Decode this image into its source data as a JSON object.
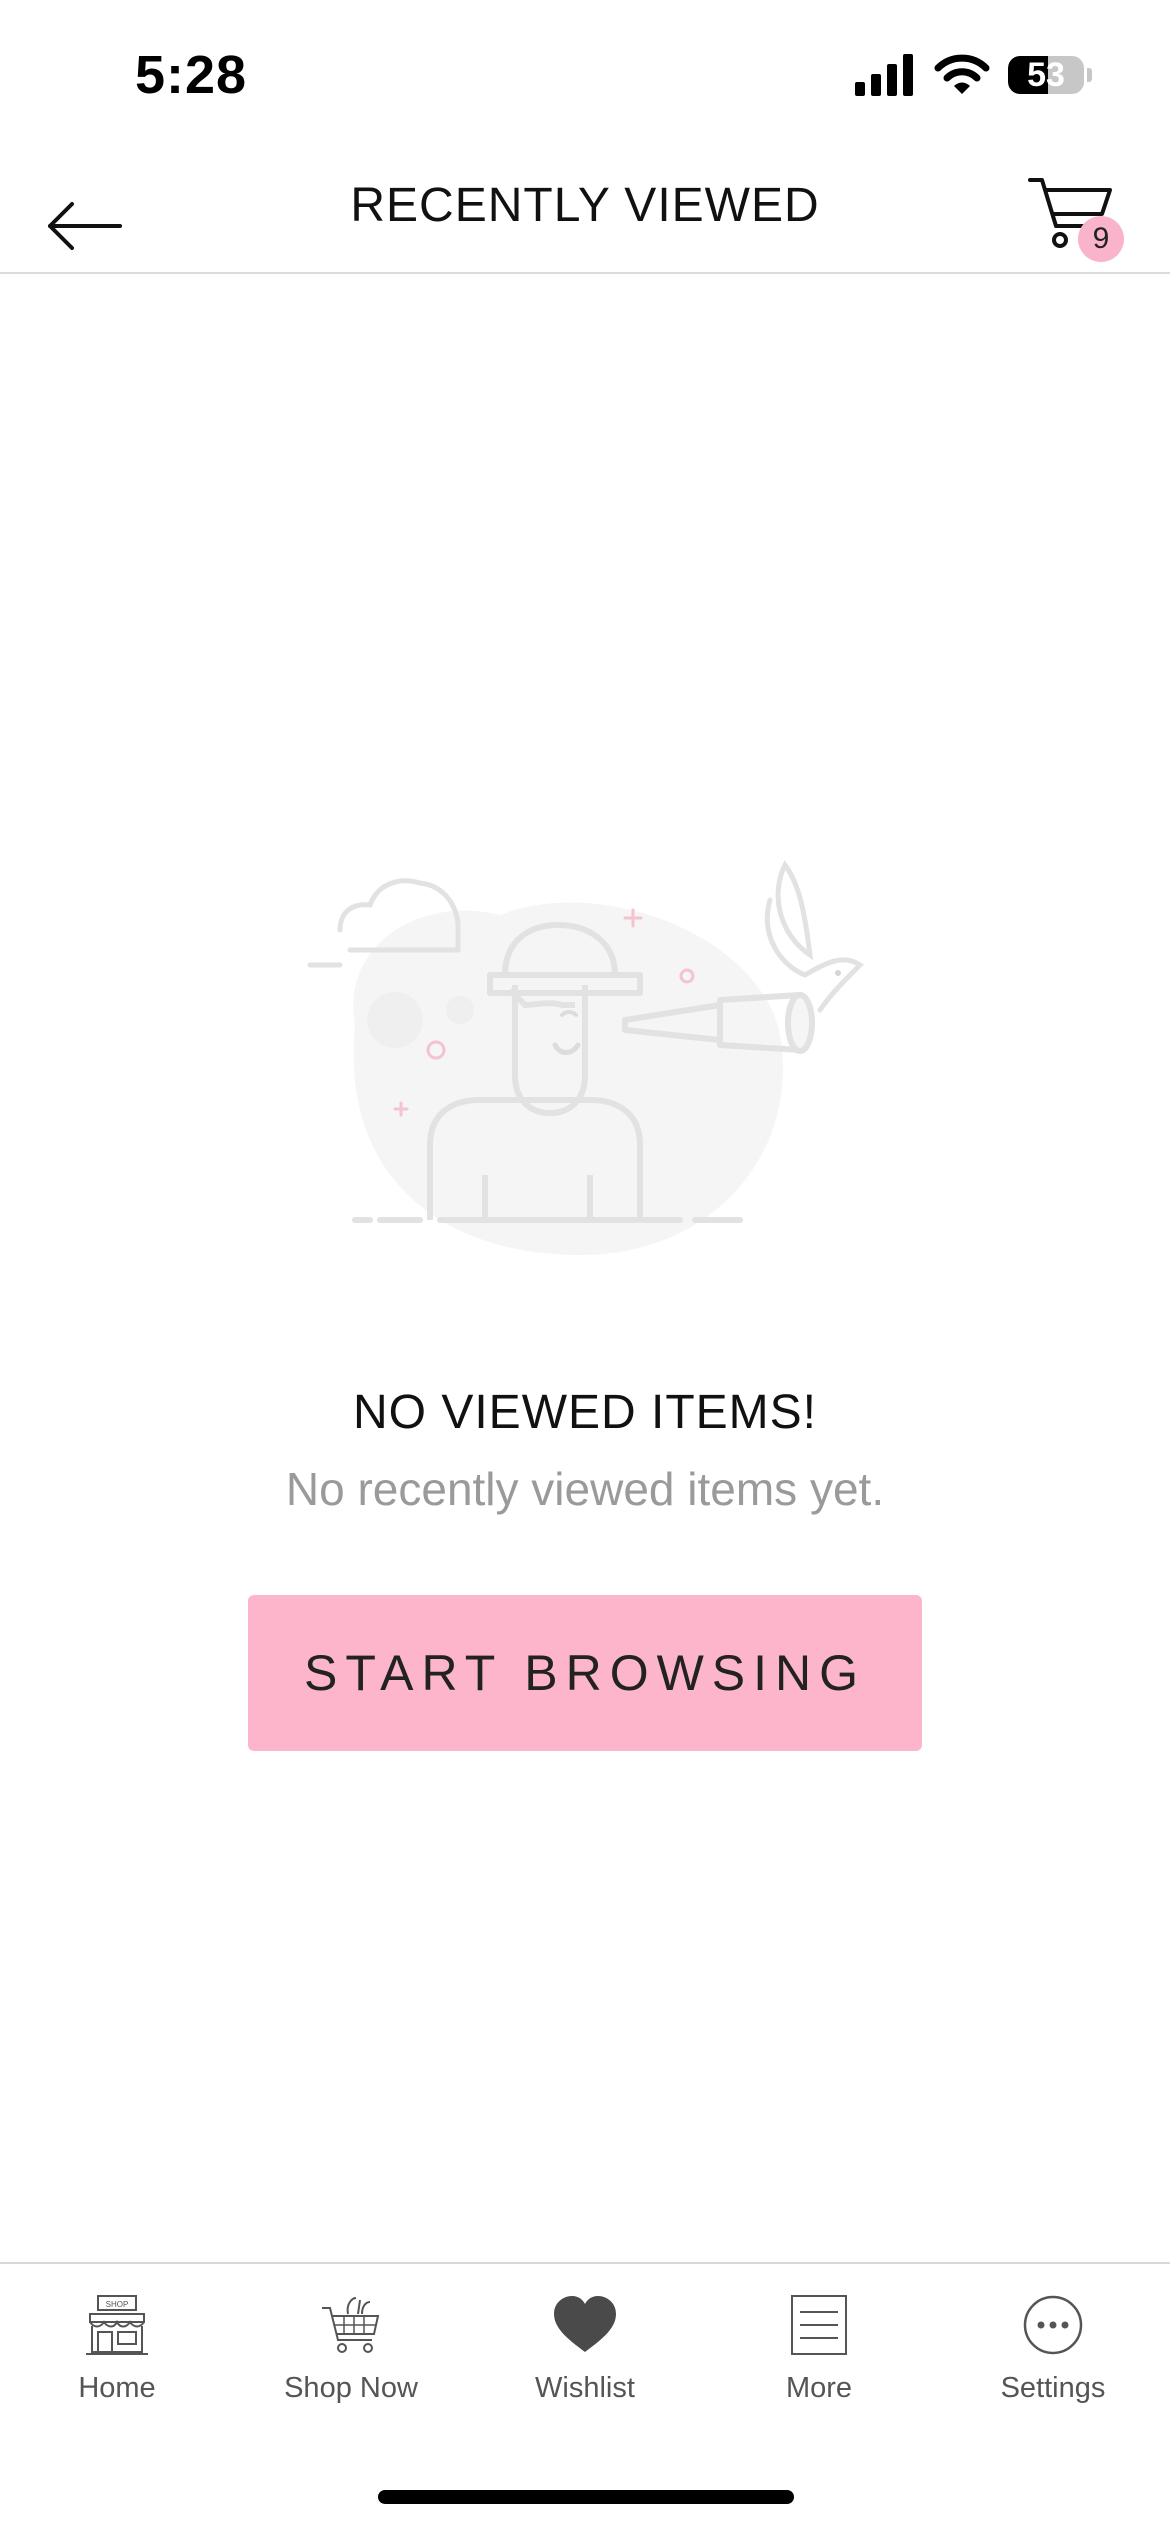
{
  "status_bar": {
    "time": "5:28",
    "battery": "53",
    "battery_level": 0.53
  },
  "header": {
    "title": "RECENTLY VIEWED",
    "cart_count": "9"
  },
  "empty_state": {
    "title": "NO VIEWED ITEMS!",
    "subtitle": "No recently viewed items yet.",
    "button_label": "START BROWSING"
  },
  "bottom_nav": {
    "items": [
      {
        "label": "Home",
        "icon": "shop-storefront-icon"
      },
      {
        "label": "Shop Now",
        "icon": "shopping-cart-icon"
      },
      {
        "label": "Wishlist",
        "icon": "heart-icon"
      },
      {
        "label": "More",
        "icon": "list-icon"
      },
      {
        "label": "Settings",
        "icon": "more-dots-icon"
      }
    ]
  },
  "colors": {
    "accent_pink": "#fdb5cc",
    "badge_pink": "#f9b4cb",
    "muted_text": "#9a9a9a"
  }
}
